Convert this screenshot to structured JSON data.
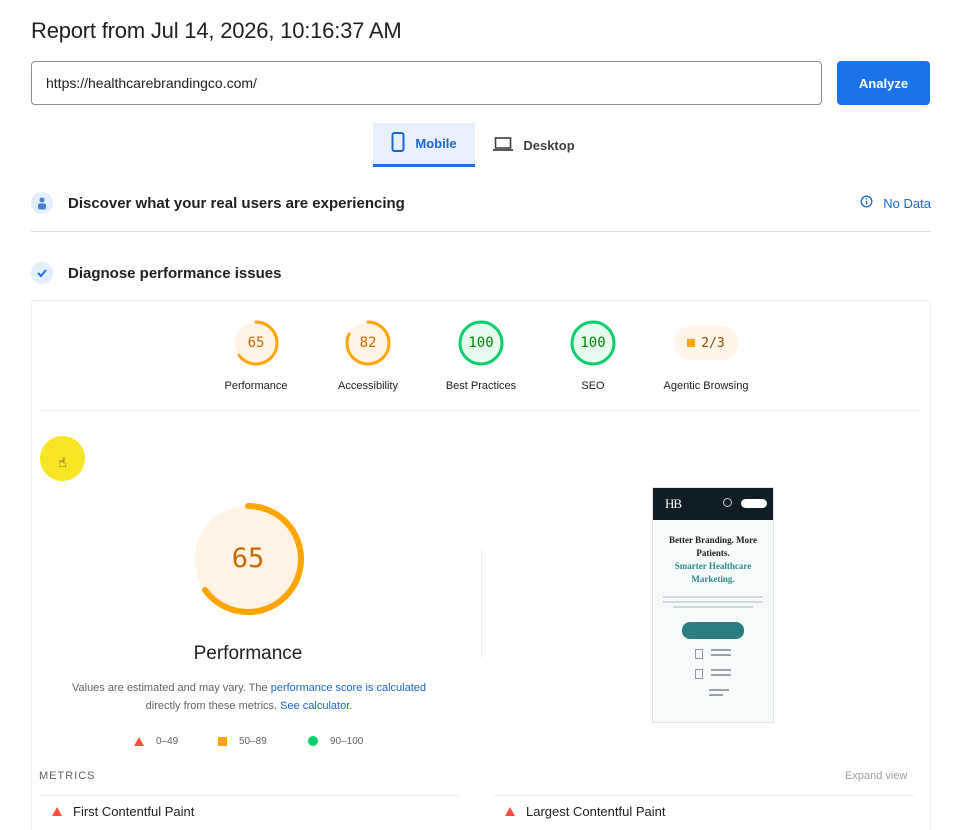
{
  "report": {
    "title": "Report from Jul 14, 2026, 10:16:37 AM"
  },
  "url_input": {
    "value": "https://healthcarebrandingco.com/"
  },
  "analyze_button": {
    "label": "Analyze"
  },
  "device_tabs": [
    {
      "label": "Mobile",
      "icon": "phone-icon",
      "selected": true
    },
    {
      "label": "Desktop",
      "icon": "laptop-icon",
      "selected": false
    }
  ],
  "crux_section": {
    "label": "Discover what your real users are experiencing",
    "status": "No Data",
    "icon": "users-icon",
    "status_icon": "info-icon"
  },
  "diagnose_section": {
    "label": "Diagnose performance issues",
    "icon": "lighthouse-icon"
  },
  "categories": [
    {
      "label": "Performance",
      "score": "65",
      "fraction": 0.65,
      "color": "#ffa400",
      "text_color": "#c76b00"
    },
    {
      "label": "Accessibility",
      "score": "82",
      "fraction": 0.82,
      "color": "#ffa400",
      "text_color": "#c76b00"
    },
    {
      "label": "Best Practices",
      "score": "100",
      "fraction": 1.0,
      "color": "#0cce6b",
      "text_color": "#008800"
    },
    {
      "label": "SEO",
      "score": "100",
      "fraction": 1.0,
      "color": "#0cce6b",
      "text_color": "#008800"
    }
  ],
  "agentic": {
    "label": "Agentic Browsing",
    "value": "2/3"
  },
  "performance": {
    "score": "65",
    "fraction": 0.65,
    "label": "Performance",
    "note_start": "Values are estimated and may vary. The ",
    "note_link1": "performance score is calculated",
    "note_mid": "directly from these metrics. ",
    "note_link2": "See calculator."
  },
  "legend": [
    {
      "range": "0–49",
      "shape": "triangle",
      "color": "#ff4e42"
    },
    {
      "range": "50–89",
      "shape": "square",
      "color": "#ffa400"
    },
    {
      "range": "90–100",
      "shape": "circle",
      "color": "#0cce6b"
    }
  ],
  "screenshot": {
    "logo": "HB",
    "headline": "Better Branding. More Patients.",
    "headline_accent": "Smarter Healthcare Marketing."
  },
  "metrics": {
    "title": "METRICS",
    "expand": "Expand view",
    "items": [
      {
        "label": "First Contentful Paint",
        "rating": "fail"
      },
      {
        "label": "Largest Contentful Paint",
        "rating": "fail"
      }
    ]
  }
}
